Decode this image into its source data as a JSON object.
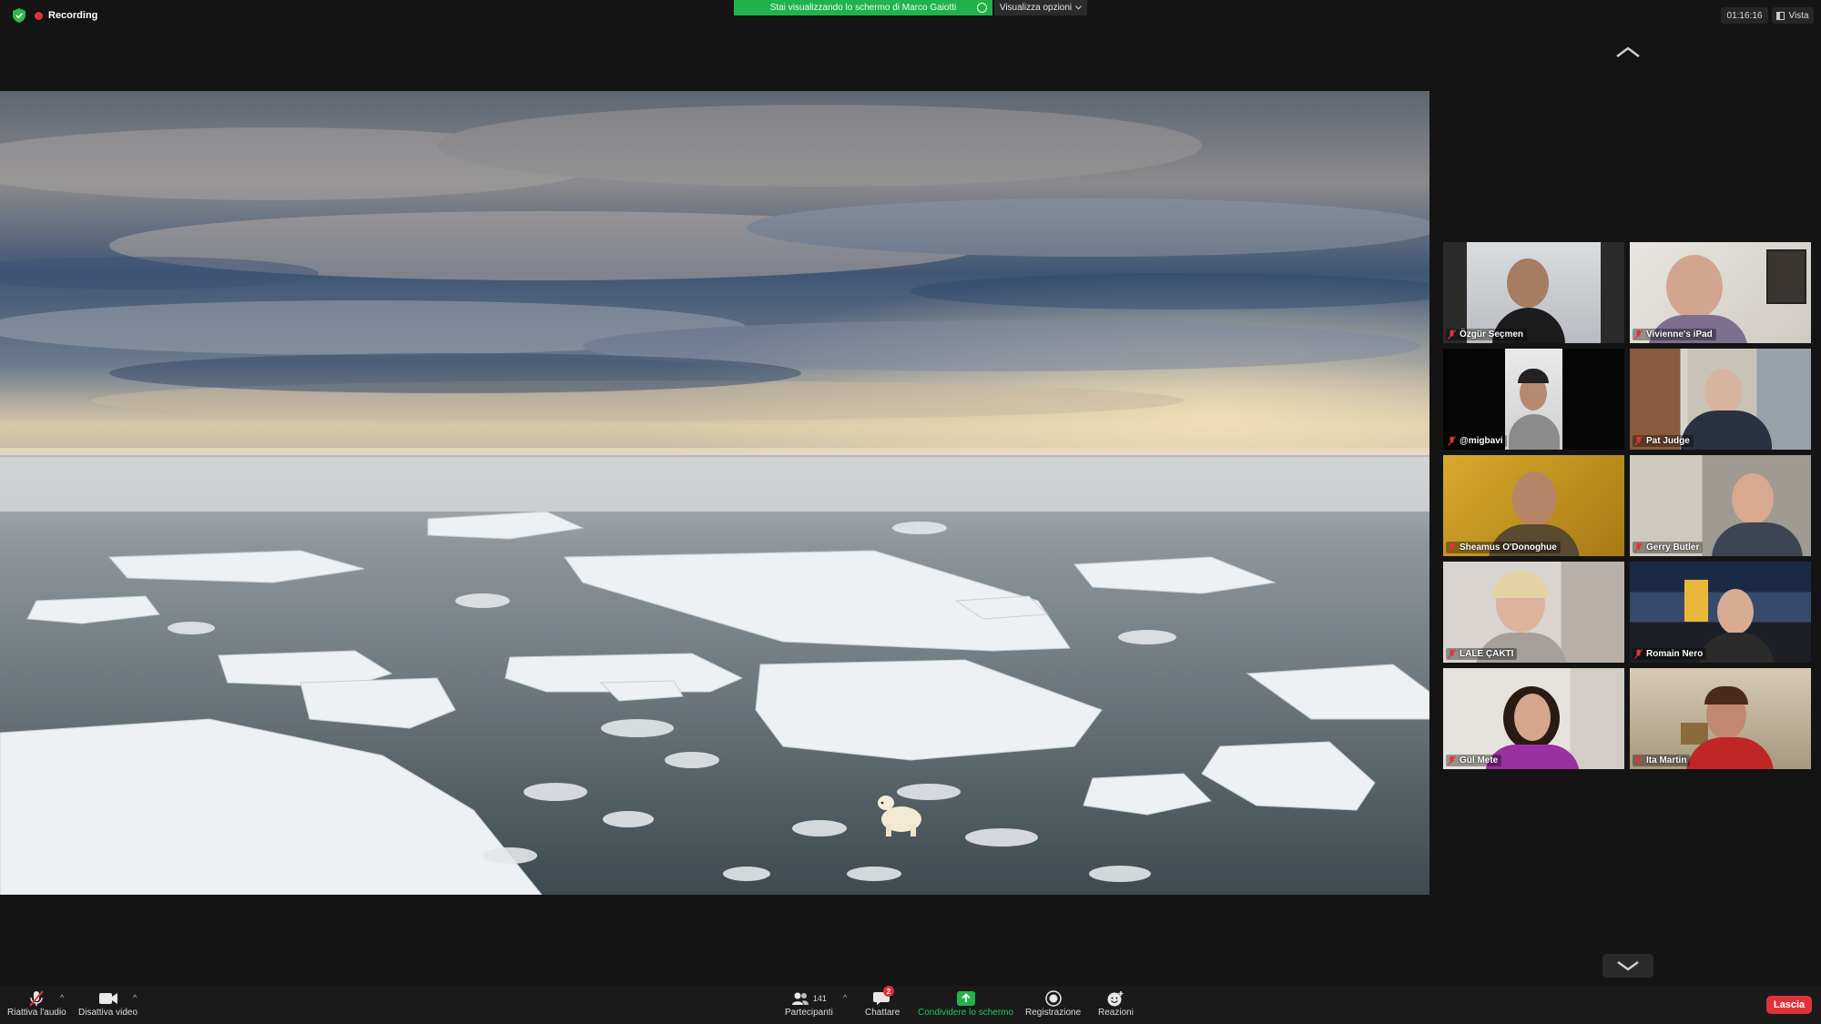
{
  "top_bar": {
    "recording_label": "Recording",
    "share_banner": "Stai visualizzando lo schermo di Marco Gaiotti",
    "view_options": "Visualizza opzioni",
    "timer": "01:16:16",
    "view_label": "Vista"
  },
  "participants": [
    {
      "name": "Özgür Seçmen",
      "muted": true
    },
    {
      "name": "Vivienne's iPad",
      "muted": true
    },
    {
      "name": "@migbavi",
      "muted": true
    },
    {
      "name": "Pat Judge",
      "muted": true
    },
    {
      "name": "Sheamus O'Donoghue",
      "muted": true
    },
    {
      "name": "Gerry Butler",
      "muted": true
    },
    {
      "name": "LALE ÇAKTI",
      "muted": true
    },
    {
      "name": "Romain Nero",
      "muted": true
    },
    {
      "name": "Gül Mete",
      "muted": true
    },
    {
      "name": "Ita Martin",
      "muted": true
    }
  ],
  "toolbar": {
    "unmute_label": "Riattiva l'audio",
    "stop_video_label": "Disattiva video",
    "participants_label": "Partecipanti",
    "participants_count": "141",
    "chat_label": "Chattare",
    "chat_badge": "2",
    "share_label": "Condividere lo schermo",
    "record_label": "Registrazione",
    "reactions_label": "Reazioni",
    "leave_label": "Lascia"
  },
  "colors": {
    "share_green": "#22b24c",
    "leave_red": "#e0323a",
    "background": "#141414"
  }
}
